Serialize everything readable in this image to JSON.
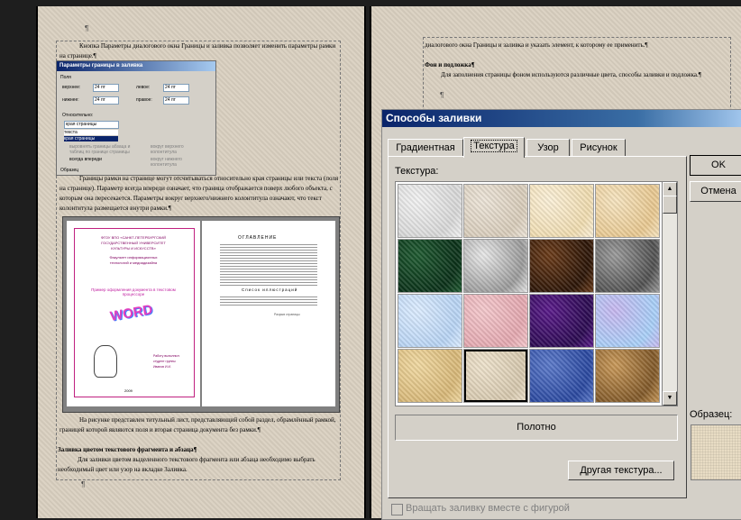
{
  "left_page": {
    "para1": "Кнопка Параметры диалогового окна Границы и заливка позволяет изменить параметры рамки на странице.¶",
    "para2": "Границы рамки на странице могут отсчитываться относительно края страницы или текста (поля на странице). Параметр всегда впереди означает, что граница отображается поверх любого объекта, с которым она пересекается. Параметры вокруг верхнего/нижнего колонтитула означают, что текст колонтитула размещается внутри рамки.¶",
    "para3": "На рисунке представлен титульный лист, представляющий собой раздел, обрамлённый рамкой, границей которой являются поля и вторая страница документа без рамки.¶",
    "heading": "Заливка цветом текстового фрагмента и абзаца¶",
    "para4": "Для заливки цветом выделенного текстового фрагмента или абзаца необходимо выбрать необходимый цвет или узор на вкладке Заливка.",
    "mark_top": "¶",
    "mark_bottom": "¶"
  },
  "borders_dialog": {
    "title": "Параметры границы в заливка",
    "group_fields": "Поля",
    "top_label": "верхнее:",
    "top_value": "24 пт",
    "bottom_label": "нижнее:",
    "bottom_value": "24 пт",
    "left_label": "левое:",
    "left_value": "24 пт",
    "right_label": "правое:",
    "right_value": "24 пт",
    "relative_label": "Относительно:",
    "relative_value": "края страницы",
    "relative_options": [
      "текста",
      "края страницы"
    ],
    "opt1": "выровнять границы абзаца и таблиц по границе страницы",
    "opt2": "вокруг верхнего колонтитула",
    "opt3": "всегда впереди",
    "opt4": "вокруг нижнего колонтитула",
    "sample_label": "Образец"
  },
  "sample_image": {
    "title_lines": [
      "ФГОУ ВПО «САНКТ-ПЕТЕРБУРГСКИЙ",
      "ГОСУДАРСТВЕННЫЙ УНИВЕРСИТЕТ",
      "КУЛЬТУРЫ И ИСКУССТВ»",
      "Факультет информационных",
      "технологий и медиадизайна"
    ],
    "example": "Пример оформления документа в текстовом процессоре",
    "word_art": "WORD",
    "performer": [
      "Работу выполнил:",
      "студент группы",
      "Иванов И.И."
    ],
    "year": "2009",
    "toc_title": "ОГЛАВЛЕНИЕ",
    "illustrations_title": "Список иллюстраций",
    "section_break": "Разрыв страницы"
  },
  "right_page": {
    "line1": "диалогового окна Границы и заливка и указать элемент, к которому ее применить.¶",
    "heading": "Фон и подложка¶",
    "line2": "Для заполнения страницы фоном используются различные цвета, способы заливки и подложка.¶",
    "mark": "¶"
  },
  "fill_dialog": {
    "title": "Способы заливки",
    "tabs": [
      "Градиентная",
      "Текстура",
      "Узор",
      "Рисунок"
    ],
    "active_tab": "Текстура",
    "texture_label": "Текстура:",
    "selected_name": "Полотно",
    "other_button": "Другая текстура...",
    "ok": "OK",
    "cancel": "Отмена",
    "sample_label": "Образец:",
    "rotate_label": "Вращать заливку вместе с фигурой",
    "textures": [
      {
        "name": "white-marble",
        "c1": "#f2f2f2",
        "c2": "#d8d8d8"
      },
      {
        "name": "paper",
        "c1": "#ece4d8",
        "c2": "#d8ccba"
      },
      {
        "name": "parchment",
        "c1": "#fbf0d8",
        "c2": "#f0dcb0"
      },
      {
        "name": "sand",
        "c1": "#f6e4c0",
        "c2": "#e8c890"
      },
      {
        "name": "green-marble",
        "c1": "#1e5a30",
        "c2": "#0a3018"
      },
      {
        "name": "gray-marble",
        "c1": "#e8e8e8",
        "c2": "#9a9a9a"
      },
      {
        "name": "brown-marble",
        "c1": "#6a3a18",
        "c2": "#2a1406"
      },
      {
        "name": "granite",
        "c1": "#9a9a9a",
        "c2": "#505050"
      },
      {
        "name": "blue-tissue",
        "c1": "#dcecff",
        "c2": "#b8d4f4"
      },
      {
        "name": "pink-tissue",
        "c1": "#f4c8cc",
        "c2": "#e4a8b0"
      },
      {
        "name": "purple-mesh",
        "c1": "#5a1a8a",
        "c2": "#2a0a50"
      },
      {
        "name": "bouquet",
        "c1": "#c8b8f0",
        "c2": "#a8d0f8"
      },
      {
        "name": "papyrus",
        "c1": "#f0d8a0",
        "c2": "#d8b878"
      },
      {
        "name": "canvas",
        "c1": "#eee2cc",
        "c2": "#d6c8ae"
      },
      {
        "name": "denim",
        "c1": "#5a78c8",
        "c2": "#2a48a0"
      },
      {
        "name": "woven-mat",
        "c1": "#c89858",
        "c2": "#805828"
      }
    ],
    "selected_index": 13,
    "colors": {
      "title_start": "#0a246a",
      "title_end": "#a6caf0",
      "dialog_bg": "#d4d0c8"
    }
  }
}
